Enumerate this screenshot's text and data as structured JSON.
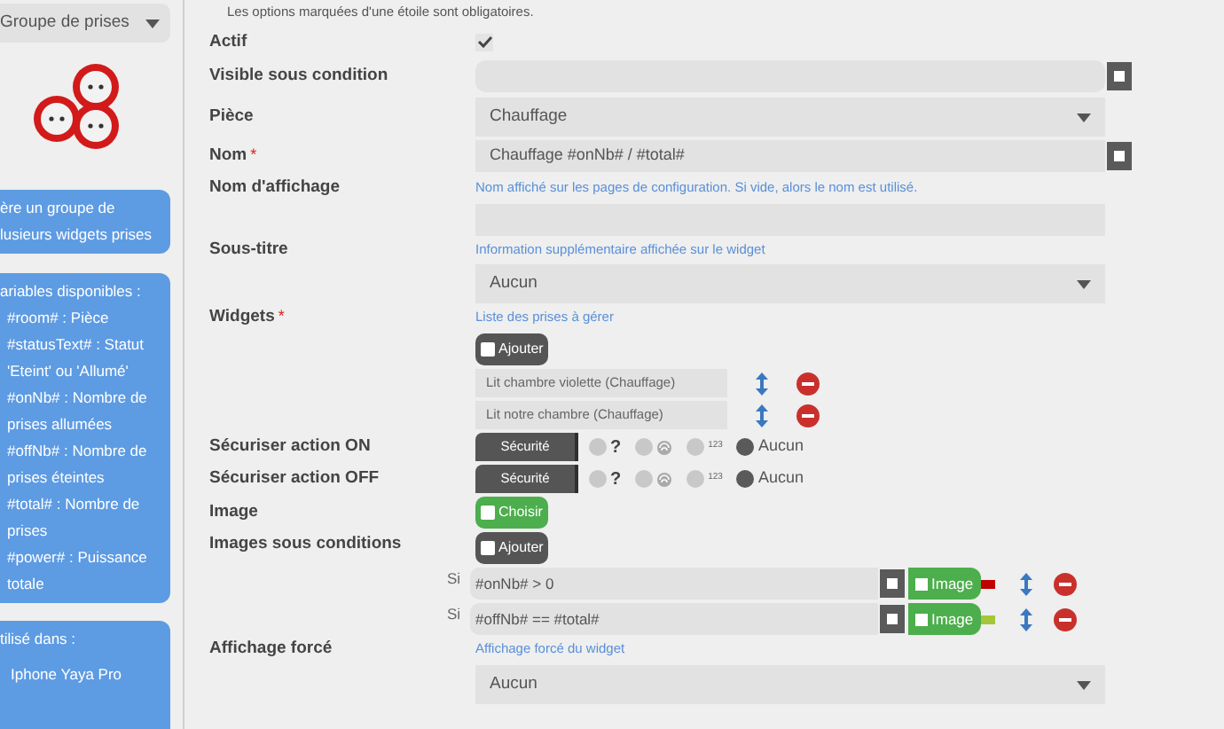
{
  "sidebar": {
    "type_select": "Groupe de prises",
    "description": [
      "ère un groupe de",
      "lusieurs widgets prises"
    ],
    "variables": {
      "title": "ariables disponibles :",
      "lines": [
        "#room# : Pièce",
        "#statusText# : Statut 'Eteint' ou 'Allumé'",
        "#onNb# : Nombre de prises allumées",
        "#offNb# : Nombre de prises éteintes",
        "#total# : Nombre de prises",
        "#power# : Puissance totale"
      ]
    },
    "used_in": {
      "title": "tilisé dans :",
      "items": [
        "Iphone Yaya Pro"
      ]
    }
  },
  "notice": "Les options marquées d'une étoile sont obligatoires.",
  "form": {
    "actif": {
      "label": "Actif",
      "checked": true
    },
    "visible": {
      "label": "Visible sous condition"
    },
    "piece": {
      "label": "Pièce",
      "value": "Chauffage"
    },
    "nom": {
      "label": "Nom",
      "required_mark": "*",
      "value": "Chauffage #onNb# / #total#"
    },
    "nom_affichage": {
      "label": "Nom d'affichage",
      "hint": "Nom affiché sur les pages de configuration. Si vide, alors le nom est utilisé."
    },
    "sous_titre": {
      "label": "Sous-titre",
      "hint": "Information supplémentaire affichée sur le widget",
      "value": "Aucun"
    },
    "widgets": {
      "label": "Widgets",
      "required_mark": "*",
      "hint": "Liste des prises à gérer",
      "add_button": "Ajouter",
      "items": [
        "Lit chambre violette (Chauffage)",
        "Lit notre chambre (Chauffage)"
      ]
    },
    "security": [
      {
        "label": "Sécuriser action ON",
        "button": "Sécurité",
        "options": [
          {
            "kind": "question",
            "text": "?",
            "selected": false
          },
          {
            "kind": "picture",
            "selected": false
          },
          {
            "kind": "number",
            "text": "123",
            "selected": false
          },
          {
            "kind": "text",
            "text": "Aucun",
            "selected": true
          }
        ]
      },
      {
        "label": "Sécuriser action OFF",
        "button": "Sécurité",
        "options": [
          {
            "kind": "question",
            "text": "?",
            "selected": false
          },
          {
            "kind": "picture",
            "selected": false
          },
          {
            "kind": "number",
            "text": "123",
            "selected": false
          },
          {
            "kind": "text",
            "text": "Aucun",
            "selected": true
          }
        ]
      }
    ],
    "image": {
      "label": "Image",
      "button": "Choisir"
    },
    "images_conditions": {
      "label": "Images sous conditions",
      "add_button": "Ajouter",
      "rows": [
        {
          "prefix": "Si",
          "condition": "#onNb# > 0",
          "button": "Image",
          "color": "#c00000"
        },
        {
          "prefix": "Si",
          "condition": "#offNb# == #total#",
          "button": "Image",
          "color": "#a4c639"
        }
      ]
    },
    "affichage_force": {
      "label": "Affichage forcé",
      "hint": "Affichage forcé du widget",
      "value": "Aucun"
    }
  }
}
